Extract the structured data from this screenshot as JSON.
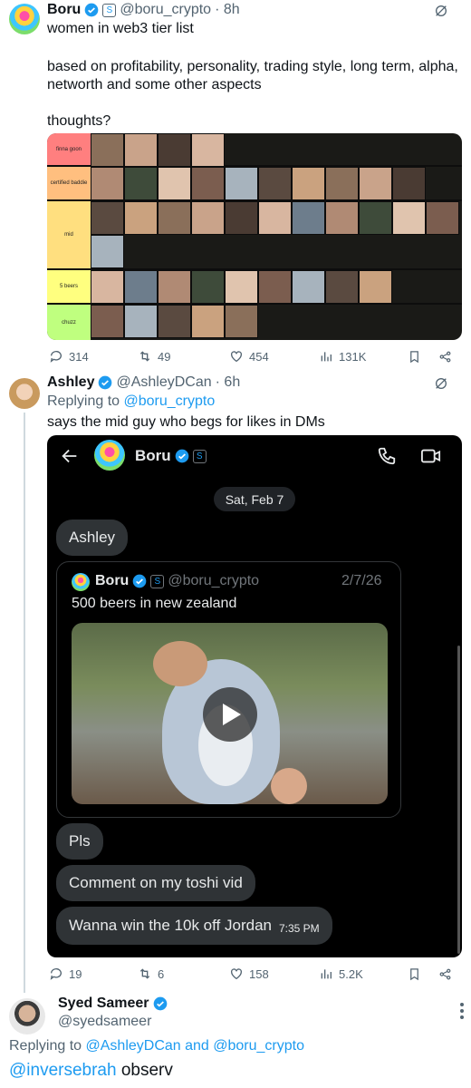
{
  "tweet1": {
    "name": "Boru",
    "handle": "@boru_crypto",
    "time": "· 8h",
    "line1": "women in web3 tier list",
    "line2": "based on profitability, personality, trading style, long term, alpha, networth and some other aspects",
    "line3": "thoughts?",
    "tiers": [
      {
        "label": "finna goon",
        "color": "#ff7f7f",
        "count": 4
      },
      {
        "label": "certified baddie",
        "color": "#ffbf7f",
        "count": 10
      },
      {
        "label": "mid",
        "color": "#ffdf7f",
        "count": 12
      },
      {
        "label": "5 beers",
        "color": "#ffff7f",
        "count": 9
      },
      {
        "label": "chuzz",
        "color": "#bfff7f",
        "count": 5
      }
    ],
    "stats": {
      "replies": "314",
      "reposts": "49",
      "likes": "454",
      "views": "131K"
    }
  },
  "tweet2": {
    "name": "Ashley",
    "handle": "@AshleyDCan",
    "time": "· 6h",
    "replying_prefix": "Replying to ",
    "replying_to": "@boru_crypto",
    "text": "says the mid guy who begs for likes in DMs",
    "dm": {
      "contact": "Boru",
      "date": "Sat, Feb 7",
      "msg1": "Ashley",
      "quote_name": "Boru",
      "quote_handle": "@boru_crypto",
      "quote_date": "2/7/26",
      "quote_text": "500 beers in new zealand",
      "msg2": "Pls",
      "msg3": "Comment on my toshi vid",
      "msg4": "Wanna win the 10k off Jordan",
      "msg4_time": "7:35 PM"
    },
    "stats": {
      "replies": "19",
      "reposts": "6",
      "likes": "158",
      "views": "5.2K"
    }
  },
  "tweet3": {
    "name": "Syed Sameer",
    "handle": "@syedsameer",
    "replying_prefix": "Replying to ",
    "replying_to": "@AshleyDCan and @boru_crypto",
    "mention": "@inversebrah",
    "text": " observ"
  },
  "colors": {
    "accent": "#1d9bf0",
    "dm_bubble": "#2f3336"
  }
}
